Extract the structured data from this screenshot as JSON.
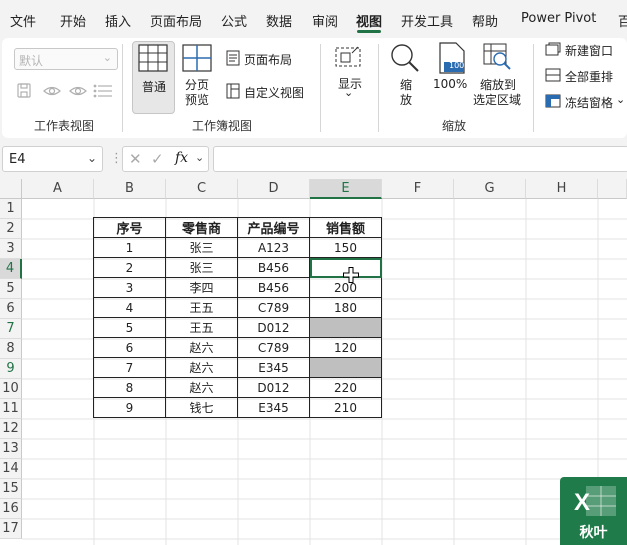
{
  "menu": {
    "items": [
      "文件",
      "开始",
      "插入",
      "页面布局",
      "公式",
      "数据",
      "审阅",
      "视图",
      "开发工具",
      "帮助",
      "Power Pivot",
      "百"
    ],
    "active": "视图"
  },
  "ribbon": {
    "sheet_view": {
      "dropdown_value": "默认",
      "group_label": "工作表视图"
    },
    "workbook_views": {
      "normal": "普通",
      "page_break_1": "分页",
      "page_break_2": "预览",
      "page_layout": "页面布局",
      "custom_views": "自定义视图",
      "group_label": "工作簿视图"
    },
    "show": {
      "label": "显示",
      "chevron": "⌄"
    },
    "zoom": {
      "zoom_1": "缩",
      "zoom_2": "放",
      "hundred": "100%",
      "icon_text": "100",
      "to_selection_1": "缩放到",
      "to_selection_2": "选定区域",
      "group_label": "缩放"
    },
    "window": {
      "new_window": "新建窗口",
      "arrange_all": "全部重排",
      "freeze_panes": "冻结窗格"
    }
  },
  "formula_bar": {
    "name_box": "E4",
    "fx": "fx",
    "formula": ""
  },
  "sheet": {
    "columns": [
      "A",
      "B",
      "C",
      "D",
      "E",
      "F",
      "G",
      "H"
    ],
    "selected_column": "E",
    "rows": [
      "1",
      "2",
      "3",
      "4",
      "5",
      "6",
      "7",
      "8",
      "9",
      "10",
      "11",
      "12",
      "13",
      "14",
      "15",
      "16",
      "17"
    ],
    "selected_row": "4",
    "table_headers": [
      "序号",
      "零售商",
      "产品编号",
      "销售额"
    ],
    "table_rows": [
      [
        "1",
        "张三",
        "A123",
        "150"
      ],
      [
        "2",
        "张三",
        "B456",
        ""
      ],
      [
        "3",
        "李四",
        "B456",
        "200"
      ],
      [
        "4",
        "王五",
        "C789",
        "180"
      ],
      [
        "5",
        "王五",
        "D012",
        ""
      ],
      [
        "6",
        "赵六",
        "C789",
        "120"
      ],
      [
        "7",
        "赵六",
        "E345",
        ""
      ],
      [
        "8",
        "赵六",
        "D012",
        "220"
      ],
      [
        "9",
        "钱七",
        "E345",
        "210"
      ]
    ]
  },
  "watermark": {
    "text": "秋叶",
    "logo_letter": "X"
  },
  "colors": {
    "accent": "#217346",
    "gray_fill": "#bfbfbf"
  }
}
